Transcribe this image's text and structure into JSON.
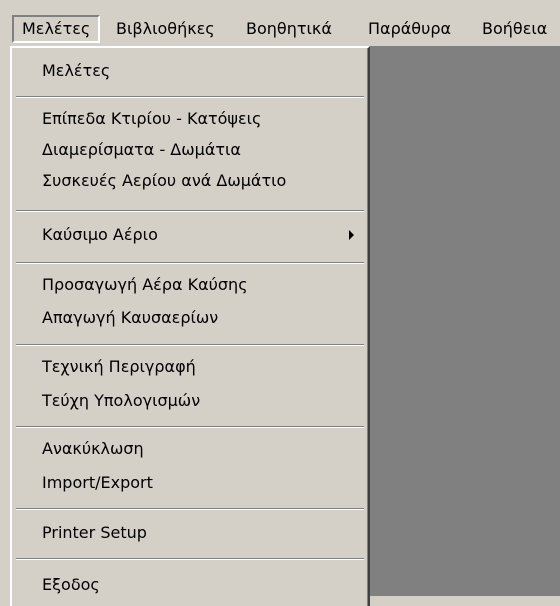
{
  "menubar": {
    "items": [
      {
        "label": "Μελέτες"
      },
      {
        "label": "Βιβλιοθήκες"
      },
      {
        "label": "Βοηθητικά"
      },
      {
        "label": "Παράθυρα"
      },
      {
        "label": "Βοήθεια"
      }
    ]
  },
  "dropdown": {
    "items": [
      {
        "label": "Μελέτες"
      },
      {
        "label": "Επίπεδα Κτιρίου - Κατόψεις"
      },
      {
        "label": "Διαμερίσματα - Δωμάτια"
      },
      {
        "label": "Συσκευές Αερίου ανά Δωμάτιο"
      },
      {
        "label": "Καύσιμο Αέριο"
      },
      {
        "label": "Προσαγωγή Αέρα Καύσης"
      },
      {
        "label": "Απαγωγή Καυσαερίων"
      },
      {
        "label": "Τεχνική Περιγραφή"
      },
      {
        "label": "Τεύχη Υπολογισμών"
      },
      {
        "label": "Ανακύκλωση"
      },
      {
        "label": "Import/Export"
      },
      {
        "label": "Printer Setup"
      },
      {
        "label": "Εξοδος"
      }
    ]
  },
  "colors": {
    "face": "#d4d0c8",
    "workspace": "#808080",
    "highlight": "#ffffff",
    "shadow": "#808080",
    "dark_shadow": "#404040"
  },
  "icons": {
    "submenu": "submenu-arrow-icon"
  }
}
